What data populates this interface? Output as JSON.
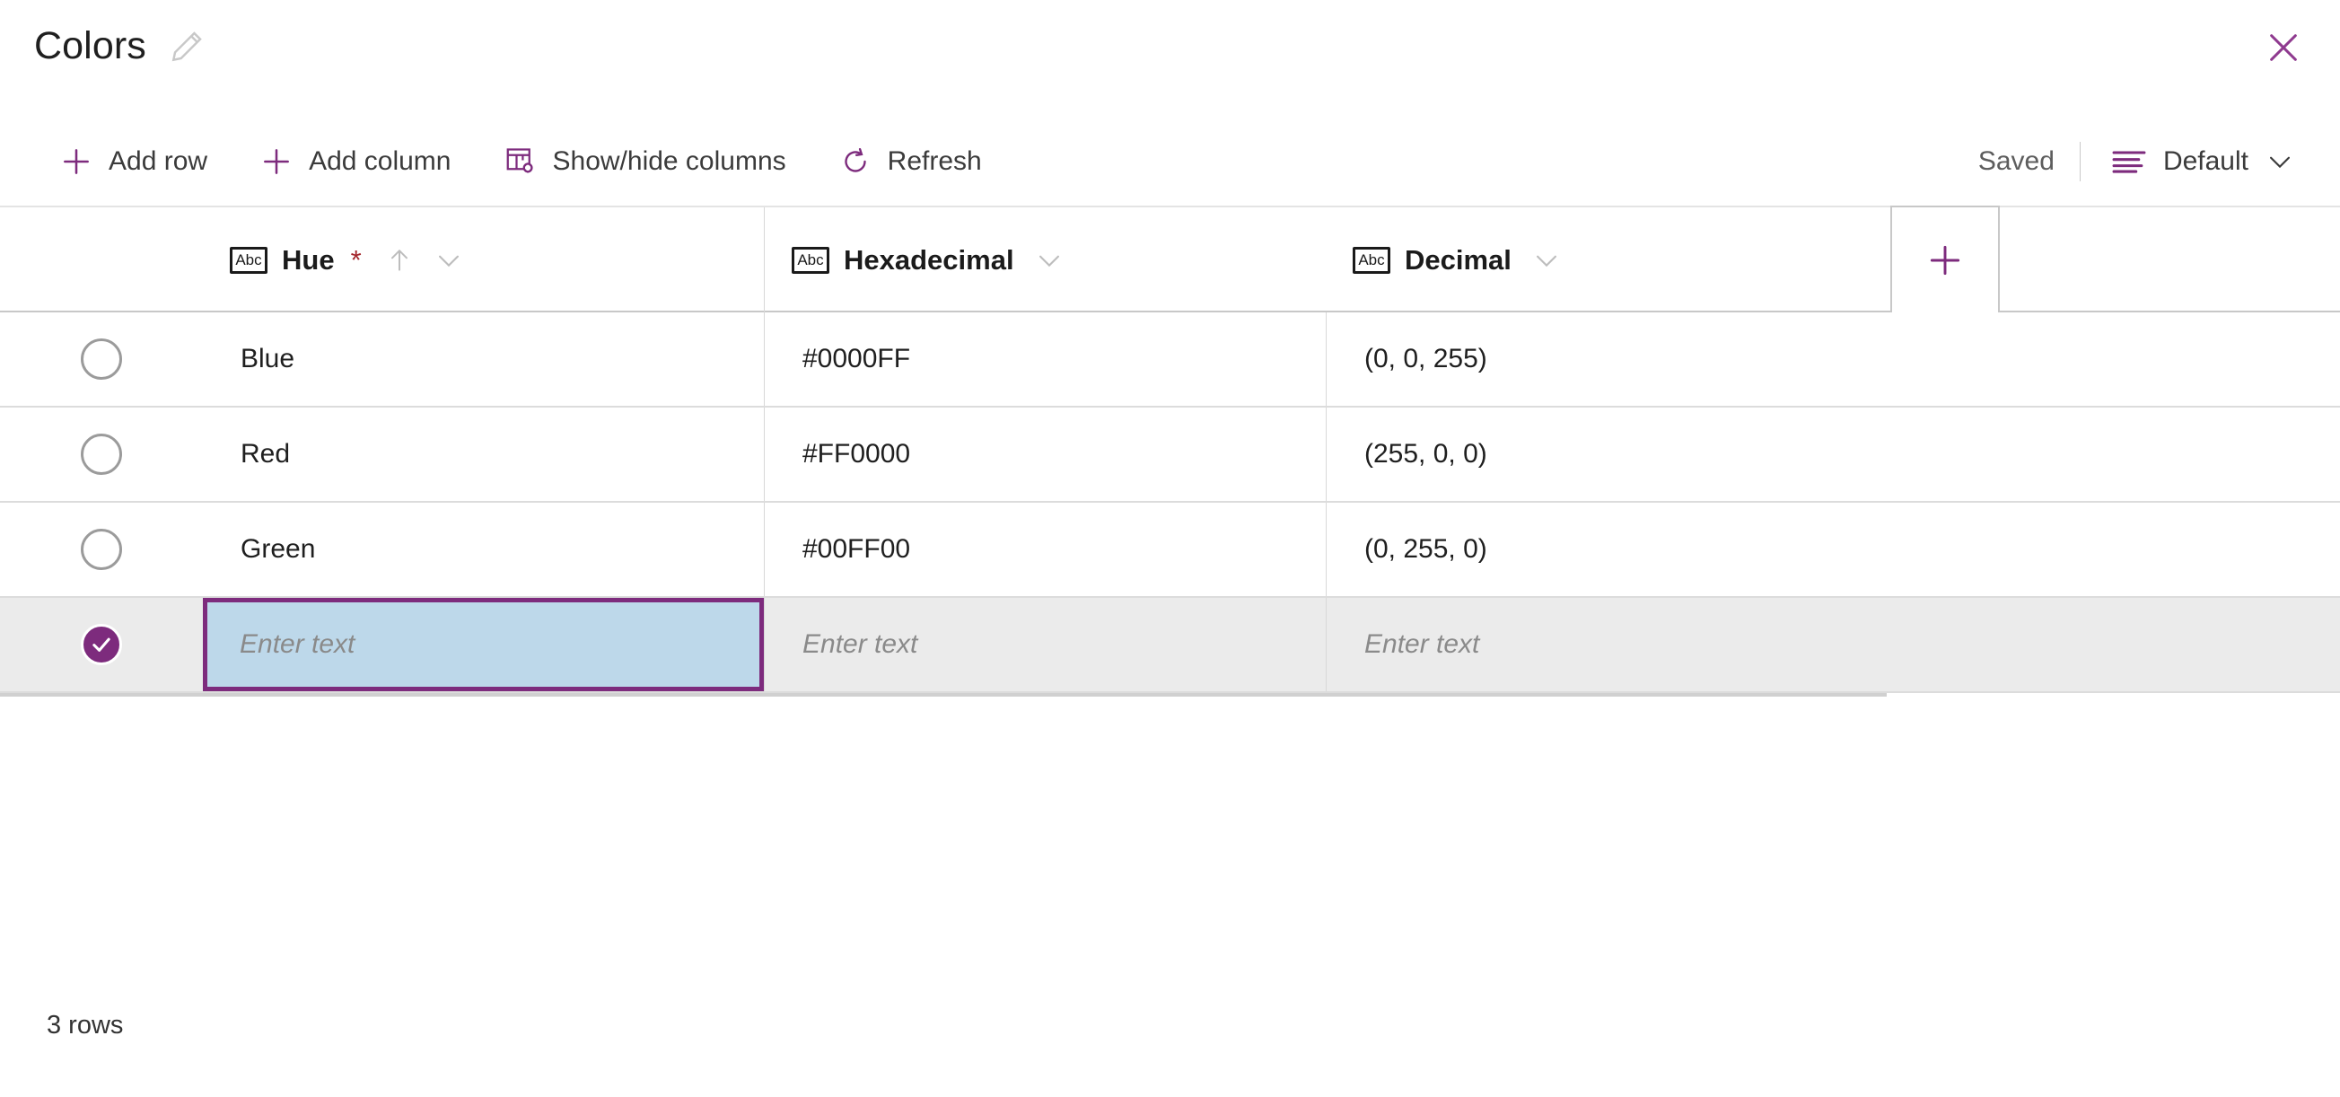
{
  "window": {
    "title": "Colors",
    "edit_icon": "pencil-icon",
    "close_icon": "close-icon"
  },
  "toolbar": {
    "items": [
      {
        "label": "Add row",
        "icon": "plus-icon"
      },
      {
        "label": "Add column",
        "icon": "plus-icon"
      },
      {
        "label": "Show/hide columns",
        "icon": "columns-settings-icon"
      },
      {
        "label": "Refresh",
        "icon": "refresh-icon"
      }
    ],
    "status": "Saved",
    "view": {
      "label": "Default",
      "icon": "view-list-icon",
      "chevron": "chevron-down-icon"
    }
  },
  "grid": {
    "add_column_button": {
      "icon": "plus-icon",
      "label": ""
    },
    "columns": [
      {
        "label": "Hue",
        "type_icon": "Abc",
        "required": "*",
        "sorted": "ascending",
        "sort_icon": "arrow-up-icon",
        "menu_icon": "chevron-down-icon"
      },
      {
        "label": "Hexadecimal",
        "type_icon": "Abc",
        "required": "",
        "sorted": "",
        "sort_icon": "",
        "menu_icon": "chevron-down-icon"
      },
      {
        "label": "Decimal",
        "type_icon": "Abc",
        "required": "",
        "sorted": "",
        "sort_icon": "",
        "menu_icon": "chevron-down-icon"
      }
    ],
    "rows": [
      {
        "selected": false,
        "hue": "Blue",
        "hexadecimal": "#0000FF",
        "decimal": "(0, 0, 255)"
      },
      {
        "selected": false,
        "hue": "Red",
        "hexadecimal": "#FF0000",
        "decimal": "(255, 0, 0)"
      },
      {
        "selected": false,
        "hue": "Green",
        "hexadecimal": "#00FF00",
        "decimal": "(0, 255, 0)"
      }
    ],
    "new_row": {
      "selected": true,
      "hue_placeholder": "Enter text",
      "hexadecimal_placeholder": "Enter text",
      "decimal_placeholder": "Enter text"
    }
  },
  "footer": {
    "row_count": "3 rows"
  },
  "colors": {
    "accent_purple": "#7d2b7d",
    "active_cell_fill": "#bdd8ea",
    "selected_row_fill": "#ebebeb",
    "required_red": "#a4262c",
    "text_primary": "#1f1f1f",
    "text_muted": "#8a8a8a"
  }
}
